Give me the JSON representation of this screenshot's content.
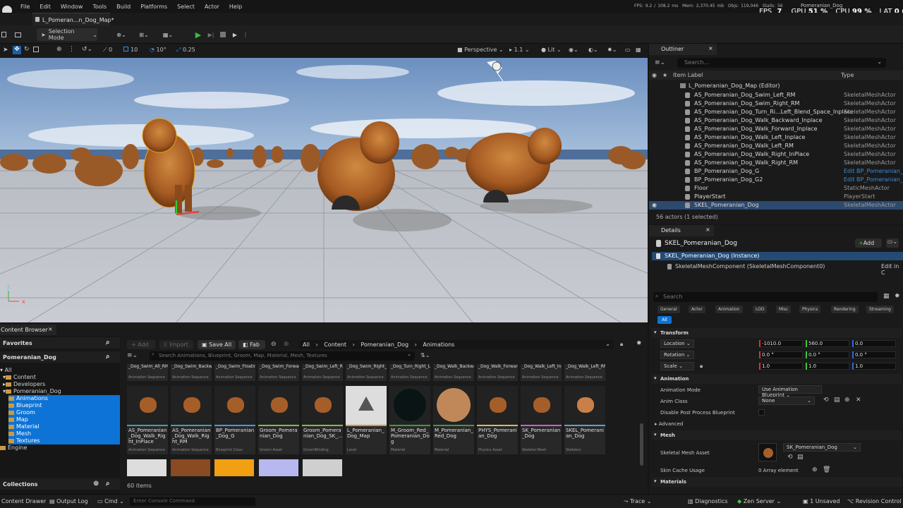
{
  "menu": [
    "File",
    "Edit",
    "Window",
    "Tools",
    "Build",
    "Platforms",
    "Select",
    "Actor",
    "Help"
  ],
  "stats": {
    "fps_small": "FPS: 9.2",
    "ms": "/ 108.2 ms",
    "mem": "Mem: 2,370.45 mb",
    "objs": "Objs: 119,046",
    "stalls": "Stalls: 56",
    "project": "Pomeranian_Dog",
    "fps_label": "FPS",
    "fps": "7",
    "gpu_label": "GPU",
    "gpu": "51 %",
    "cpu_label": "CPU",
    "cpu": "99 %",
    "lat_label": "LAT",
    "lat": "0 m"
  },
  "doc_tab": "L_Pomeran...n_Dog_Map*",
  "toolbar": {
    "mode": "Selection Mode"
  },
  "viewport_toolbar": {
    "snap_rot": "0",
    "grid": "10",
    "angle": "10°",
    "scale": "0.25",
    "view": "Perspective",
    "speed": "1.1",
    "lit": "Lit"
  },
  "axis": {
    "x": "x",
    "z": "z"
  },
  "outliner": {
    "tab": "Outliner",
    "search_placeholder": "Search...",
    "col_label": "Item Label",
    "col_type": "Type",
    "root": "L_Pomeranian_Dog_Map (Editor)",
    "rows": [
      {
        "label": "AS_Pomeranian_Dog_Swim_Left_RM",
        "type": "SkeletalMeshActor"
      },
      {
        "label": "AS_Pomeranian_Dog_Swim_Right_RM",
        "type": "SkeletalMeshActor"
      },
      {
        "label": "AS_Pomeranian_Dog_Turn_Ri...Left_Blend_Space_Inplace",
        "type": "SkeletalMeshActor"
      },
      {
        "label": "AS_Pomeranian_Dog_Walk_Backward_Inplace",
        "type": "SkeletalMeshActor"
      },
      {
        "label": "AS_Pomeranian_Dog_Walk_Forward_Inplace",
        "type": "SkeletalMeshActor"
      },
      {
        "label": "AS_Pomeranian_Dog_Walk_Left_Inplace",
        "type": "SkeletalMeshActor"
      },
      {
        "label": "AS_Pomeranian_Dog_Walk_Left_RM",
        "type": "SkeletalMeshActor"
      },
      {
        "label": "AS_Pomeranian_Dog_Walk_Right_InPlace",
        "type": "SkeletalMeshActor"
      },
      {
        "label": "AS_Pomeranian_Dog_Walk_Right_RM",
        "type": "SkeletalMeshActor"
      },
      {
        "label": "BP_Pomeranian_Dog_G",
        "type": "Edit BP_Pomeranian_Dog"
      },
      {
        "label": "BP_Pomeranian_Dog_G2",
        "type": "Edit BP_Pomeranian_Dog"
      },
      {
        "label": "Floor",
        "type": "StaticMeshActor"
      },
      {
        "label": "PlayerStart",
        "type": "PlayerStart"
      },
      {
        "label": "SKEL_Pomeranian_Dog",
        "type": "SkeletalMeshActor"
      }
    ],
    "footer": "56 actors (1 selected)"
  },
  "details": {
    "tab": "Details",
    "actor": "SKEL_Pomeranian_Dog",
    "add": "Add",
    "instance": "SKEL_Pomeranian_Dog (Instance)",
    "component": "SkeletalMeshComponent (SkeletalMeshComponent0)",
    "edit_in": "Edit in C",
    "search_placeholder": "Search",
    "filters": [
      "General",
      "Actor",
      "Animation",
      "LOD",
      "Misc",
      "Physics",
      "Rendering",
      "Streaming"
    ],
    "all": "All",
    "transform": "Transform",
    "location": "Location",
    "rotation": "Rotation",
    "scale": "Scale",
    "loc": [
      "-1010.0",
      "560.0",
      "0.0"
    ],
    "rot": [
      "0.0 °",
      "0.0 °",
      "0.0 °"
    ],
    "scl": [
      "1.0",
      "1.0",
      "1.0"
    ],
    "animation": "Animation",
    "anim_mode": "Animation Mode",
    "anim_mode_val": "Use Animation Blueprint",
    "anim_class": "Anim Class",
    "anim_class_val": "None",
    "disable_pp": "Disable Post Process Blueprint",
    "advanced": "Advanced",
    "mesh": "Mesh",
    "skm_asset": "Skeletal Mesh Asset",
    "skm_val": "SK_Pomeranian_Dog",
    "skin_cache": "Skin Cache Usage",
    "skin_val": "0 Array element",
    "materials": "Materials"
  },
  "content_browser": {
    "tab": "Content Browser",
    "favorites": "Favorites",
    "fav_item": "Pomeranian_Dog",
    "tree": [
      "All",
      "Content",
      "Developers",
      "Pomeranian_Dog",
      "Animations",
      "Blueprint",
      "Groom",
      "Map",
      "Material",
      "Mesh",
      "Textures",
      "Engine"
    ],
    "collections": "Collections",
    "add": "Add",
    "import": "Import",
    "save_all": "Save All",
    "fab": "Fab",
    "crumbs": [
      "All",
      "Content",
      "Pomeranian_Dog",
      "Animations"
    ],
    "search_placeholder": "Search Animations, Blueprint, Groom, Map, Material, Mesh, Textures",
    "top_row": [
      {
        "name": "_Dog_Swim_All_RM",
        "type": "Animation Sequence"
      },
      {
        "name": "_Dog_Swim_Backward",
        "type": "Animation Sequence"
      },
      {
        "name": "_Dog_Swim_Floating",
        "type": "Animation Sequence"
      },
      {
        "name": "_Dog_Swim_Forward_2",
        "type": "Animation Sequence"
      },
      {
        "name": "_Dog_Swim_Left_RM",
        "type": "Animation Sequence"
      },
      {
        "name": "_Dog_Swim_Right_RM",
        "type": "Animation Sequence"
      },
      {
        "name": "_Dog_Turn_Right_Left...",
        "type": "Animation Sequence"
      },
      {
        "name": "_Dog_Walk_Backward_...",
        "type": "Animation Sequence"
      },
      {
        "name": "_Dog_Walk_Forward_...",
        "type": "Animation Sequence"
      },
      {
        "name": "_Dog_Walk_Left_Inplace",
        "type": "Animation Sequence"
      },
      {
        "name": "_Dog_Walk_Left_RM",
        "type": "Animation Sequence"
      }
    ],
    "assets": [
      {
        "name": "AS_Pomeranian_Dog_Walk_Right_InPlace",
        "type": "Animation Sequence",
        "color": "#2fa8b8"
      },
      {
        "name": "AS_Pomeranian_Dog_Walk_Right_RM",
        "type": "Animation Sequence",
        "color": "#2fa8b8"
      },
      {
        "name": "BP_Pomeranian_Dog_G",
        "type": "Blueprint Class",
        "color": "#3aa0e0"
      },
      {
        "name": "Groom_Pomeranian_Dog",
        "type": "Groom Asset",
        "color": "#7fbf3f"
      },
      {
        "name": "Groom_Pomeranian_Dog_SK_...",
        "type": "GroomBinding",
        "color": "#7fbf3f"
      },
      {
        "name": "L_Pomeranian_Dog_Map",
        "type": "Level",
        "color": "#c89a30"
      },
      {
        "name": "M_Groom_Red_Pomeranian_Dog",
        "type": "Material",
        "color": "#3c9c3c"
      },
      {
        "name": "M_Pomeranian_Red_Dog",
        "type": "Material",
        "color": "#3c9c3c"
      },
      {
        "name": "PHYS_Pomeranian_Dog",
        "type": "Physics Asset",
        "color": "#d0c060"
      },
      {
        "name": "SK_Pomeranian_Dog",
        "type": "Skeletal Mesh",
        "color": "#d060c0"
      },
      {
        "name": "SKEL_Pomeranian_Dog",
        "type": "Skeleton",
        "color": "#60a0d0"
      }
    ],
    "count": "60 items"
  },
  "status": {
    "drawer": "Content Drawer",
    "output": "Output Log",
    "cmd": "Cmd",
    "console_placeholder": "Enter Console Command",
    "trace": "Trace",
    "diagnostics": "Diagnostics",
    "zen": "Zen Server",
    "unsaved": "1 Unsaved",
    "revision": "Revision Control"
  }
}
